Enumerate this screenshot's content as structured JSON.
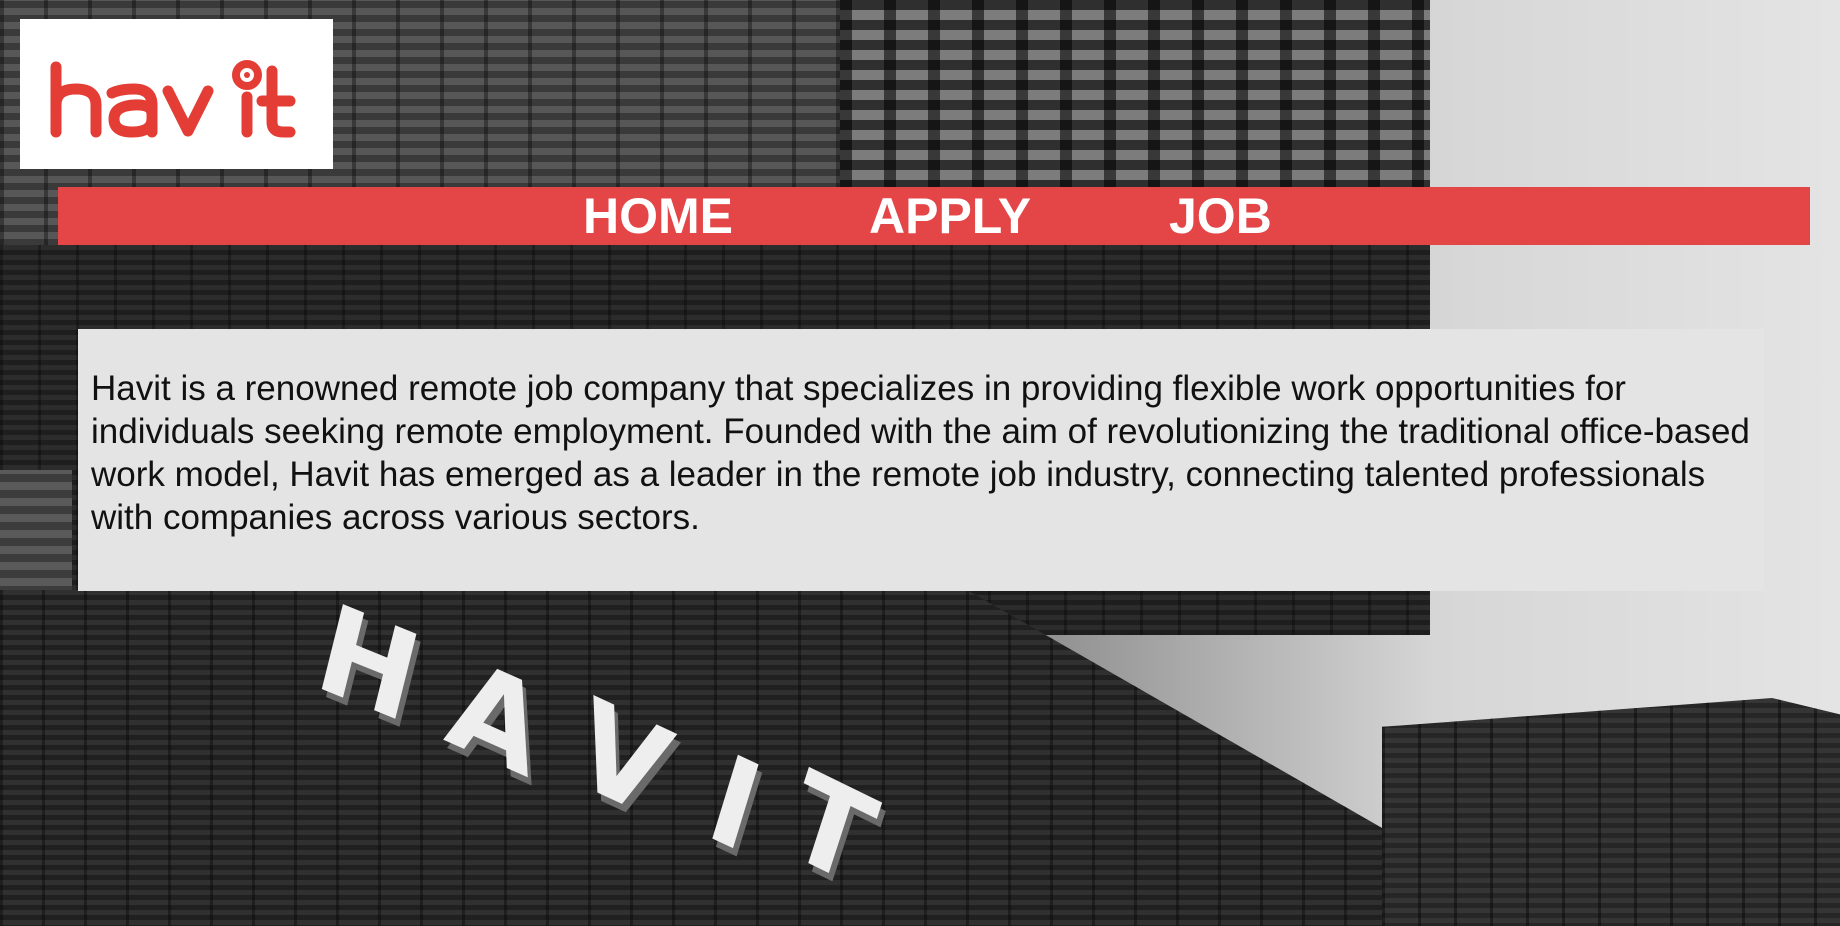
{
  "logo": {
    "text": "havit",
    "brand_color": "#e43d35",
    "background": "#ffffff"
  },
  "nav": {
    "background": "#e44547",
    "text_color": "#ffffff",
    "items": [
      {
        "label": "HOME"
      },
      {
        "label": "APPLY"
      },
      {
        "label": "JOB"
      }
    ]
  },
  "background_sign": {
    "letters": [
      "H",
      "A",
      "V",
      "I",
      "T"
    ]
  },
  "info": {
    "background": "#e4e4e4",
    "text": "Havit is a renowned remote job company that specializes in providing flexible work opportunities for individuals seeking remote employment. Founded with the aim of revolutionizing the traditional office-based work model, Havit has emerged as a leader in the remote job industry, connecting talented professionals with companies across various sectors."
  }
}
